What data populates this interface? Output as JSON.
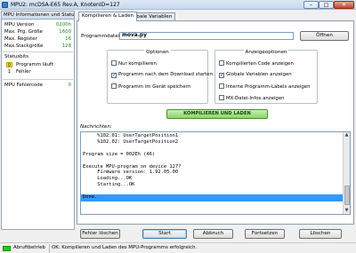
{
  "window": {
    "title": "MPU2: mcDSA-E65 Rev.A, KnotenID=127",
    "min": "–",
    "max": "□",
    "close": "✕"
  },
  "left_panel": {
    "header": "MPU Informationen und Status",
    "rows": [
      {
        "label": "MPU Version",
        "value": "0200h"
      },
      {
        "label": "Max. Prg. Größe",
        "value": "1600"
      },
      {
        "label": "Max. Register",
        "value": "16"
      },
      {
        "label": "Max.Stackgröße",
        "value": "128"
      }
    ],
    "statusbits_label": "Statusbits",
    "statusbits": [
      {
        "bit": "0",
        "label": "Programm läuft",
        "active": true
      },
      {
        "bit": "1",
        "label": "Fehler",
        "active": false
      }
    ],
    "fehlercode_label": "MPU Fehlercode",
    "fehlercode_value": "0"
  },
  "tabs": [
    {
      "label": "Kompilieren & Laden",
      "active": true
    },
    {
      "label": "Globale Variablen",
      "active": false
    }
  ],
  "program": {
    "file_label": "Programmdatei",
    "file_value": "mova.py",
    "open_button": "Öffnen"
  },
  "options": {
    "title": "Optionen",
    "items": [
      {
        "label": "Nur kompilieren",
        "checked": false
      },
      {
        "label": "Programm nach dem Download starten",
        "checked": true
      },
      {
        "label": "Programm im Gerät speichern",
        "checked": false
      }
    ]
  },
  "display_options": {
    "title": "Anzeigeoptionen",
    "items": [
      {
        "label": "Kompilierten Code anzeigen",
        "checked": false
      },
      {
        "label": "Globale Variablen anzeigen",
        "checked": true
      },
      {
        "label": "Interne Programm-Labels anzeigen",
        "checked": false
      },
      {
        "label": "MX-Datei-Infos anzeigen",
        "checked": false
      }
    ]
  },
  "compile_button": "KOMPILIEREN UND LADEN",
  "messages": {
    "label": "Nachrichten:",
    "text": "     %102.01: UserTargetPosition1\n     %102.02: UserTargetPosition2\n\nProgram size = 002Eh (46)\n\nExecute MPU-program on device 127?\n     Firmware version: 1.92.05.00\n     Loading...OK\n     Starting...OK\n\nDone."
  },
  "buttons": {
    "clear_errors": "Fehler löschen",
    "start": "Start",
    "abort": "Abbruch",
    "continue": "Fortsetzen",
    "delete": "Löschen"
  },
  "statusbar": {
    "mode": "Abruftbetrieb",
    "message": "OK: Kompilieren und Laden des MPU-Programms erfolgreich."
  },
  "colors": {
    "led_green": "#13d613",
    "compile_button": "#8bd468",
    "status_active": "#f6ef00",
    "selection": "#3399ff"
  }
}
